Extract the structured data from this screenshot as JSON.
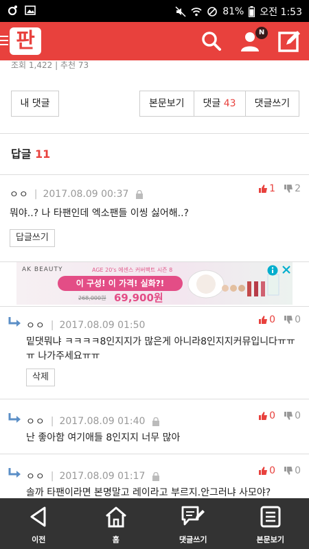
{
  "status_bar": {
    "battery": "81%",
    "time": "오전 1:53"
  },
  "header": {
    "logo": "판",
    "notification_badge": "N",
    "accent_color": "#e8413d"
  },
  "post": {
    "stats_partial": "조회 1,422  |  추천 73"
  },
  "actions": {
    "my_comments": "내 댓글",
    "view_post": "본문보기",
    "comments_label": "댓글",
    "comments_count": "43",
    "write_comment": "댓글쓰기"
  },
  "replies": {
    "title": "답글",
    "count": "11"
  },
  "comments": [
    {
      "nickname": "ㅇㅇ",
      "date": "2017.08.09 00:37",
      "text": "뭐야..? 나 타팬인데 엑소팬들 이씽 싫어해..?",
      "action": "답글쓰기",
      "up": "1",
      "down": "2",
      "icon": "lock-icon"
    },
    {
      "nickname": "ㅇㅇ",
      "date": "2017.08.09 01:50",
      "text": "밑댓뭐냐 ㅋㅋㅋㅋ8인지지가 많은게 아니라8인지지커뮤입니다ㅠㅠㅠ 나가주세요ㅠㅠ",
      "action": "삭제",
      "up": "0",
      "down": "0"
    },
    {
      "nickname": "ㅇㅇ",
      "date": "2017.08.09 01:40",
      "text": "난 좋아함 여기애들 8인지지 너무 많아",
      "up": "0",
      "down": "0",
      "icon": "lock-icon"
    },
    {
      "nickname": "ㅇㅇ",
      "date": "2017.08.09 01:17",
      "text": "솔까 타팬이라면 본명말고 레이라고 부르지.안그러냐 사모야?",
      "up": "0",
      "down": "0",
      "icon": "lock-icon"
    }
  ],
  "ad": {
    "brand": "AK BEAUTY",
    "subtitle": "AGE 20's 에센스 커버팩트 시즌 8",
    "headline": "이 구성! 이 가격! 실화?!",
    "old_price": "268,000원",
    "price": "69,900원"
  },
  "bottom_nav": [
    {
      "label": "이전",
      "icon": "back-icon"
    },
    {
      "label": "홈",
      "icon": "home-icon"
    },
    {
      "label": "댓글쓰기",
      "icon": "write-comment-icon"
    },
    {
      "label": "본문보기",
      "icon": "document-icon"
    }
  ]
}
